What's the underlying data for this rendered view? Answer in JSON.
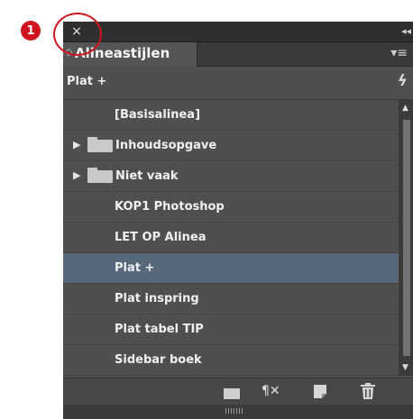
{
  "annotation": {
    "marker": "1"
  },
  "panel": {
    "close_symbol": "×",
    "collapse_symbol": "◂◂",
    "tab": {
      "grip": "◇",
      "title": "Alineastijlen"
    },
    "menu_symbol": "▾≡",
    "current_style": "Plat +",
    "quick_apply_symbol": "ϟ",
    "styles": [
      {
        "label": "[Basisalinea]",
        "type": "style",
        "selected": false
      },
      {
        "label": "Inhoudsopgave",
        "type": "folder",
        "selected": false
      },
      {
        "label": "Niet vaak",
        "type": "folder",
        "selected": false
      },
      {
        "label": "KOP1 Photoshop",
        "type": "style",
        "selected": false
      },
      {
        "label": "LET OP Alinea",
        "type": "style",
        "selected": false
      },
      {
        "label": "Plat +",
        "type": "style",
        "selected": true
      },
      {
        "label": "Plat inspring",
        "type": "style",
        "selected": false
      },
      {
        "label": "Plat tabel TIP",
        "type": "style",
        "selected": false
      },
      {
        "label": "Sidebar boek",
        "type": "style",
        "selected": false
      }
    ],
    "footer": {
      "new_group_icon": "folder-icon",
      "clear_overrides_symbol": "¶✕",
      "new_style_icon": "new-page-icon",
      "delete_icon": "trash-icon"
    },
    "colors": {
      "panel_bg": "#4f4f4f",
      "selected_row": "#57687a",
      "annotation_red": "#d0141e"
    }
  }
}
